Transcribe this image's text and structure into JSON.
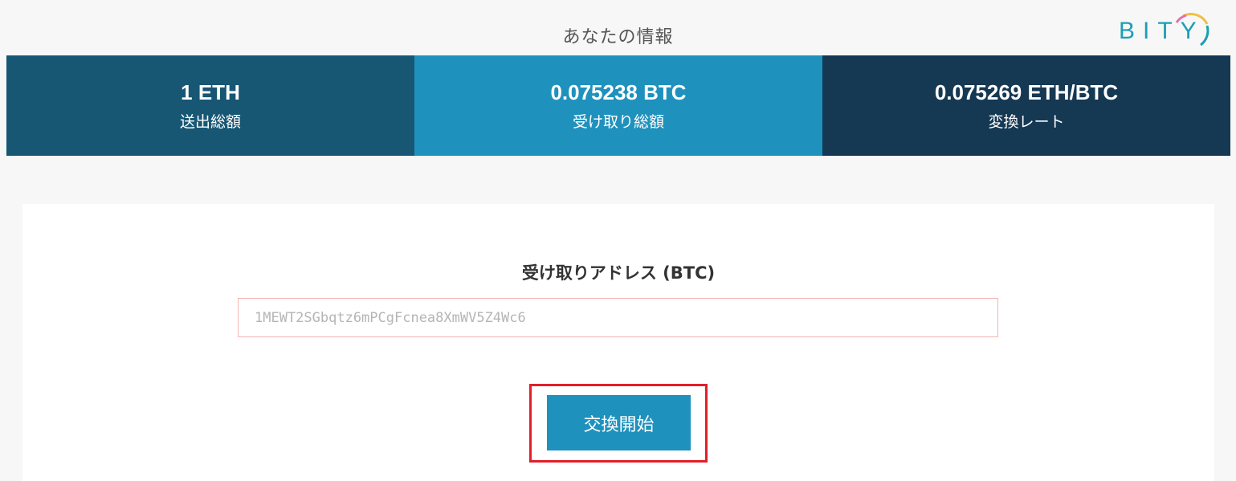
{
  "header": {
    "title": "あなたの情報",
    "logo_text": "BITY"
  },
  "stats": [
    {
      "value": "1 ETH",
      "label": "送出総額"
    },
    {
      "value": "0.075238 BTC",
      "label": "受け取り総額"
    },
    {
      "value": "0.075269 ETH/BTC",
      "label": "変換レート"
    }
  ],
  "form": {
    "address_label": "受け取りアドレス (BTC)",
    "address_placeholder": "1MEWT2SGbqtz6mPCgFcnea8XmWV5Z4Wc6",
    "submit_label": "交換開始"
  },
  "colors": {
    "stat_1_bg": "#175774",
    "stat_2_bg": "#1f91bd",
    "stat_3_bg": "#153853",
    "button_bg": "#1f91bd",
    "highlight": "#e0202a",
    "logo": "#1a9fb5"
  }
}
